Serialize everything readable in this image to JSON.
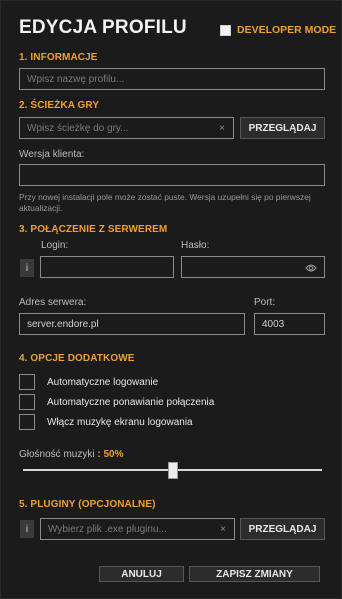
{
  "header": {
    "title": "EDYCJA PROFILU",
    "developer_mode_label": "DEVELOPER MODE",
    "developer_mode_checked": false
  },
  "sections": {
    "info": "1. INFORMACJE",
    "game_path": "2. ŚCIEŻKA GRY",
    "server": "3. POŁĄCZENIE Z SERWEREM",
    "extra": "4. OPCJE DODATKOWE",
    "plugins": "5. PLUGINY (OPCJONALNE)"
  },
  "profile_name": {
    "placeholder": "Wpisz nazwę profilu..."
  },
  "game_path": {
    "placeholder": "Wpisz ścieżkę do gry...",
    "clear_glyph": "×",
    "browse_label": "PRZEGLĄDAJ"
  },
  "client_version": {
    "label": "Wersja klienta:",
    "value": "",
    "note": "Przy nowej instalacji pole może zostać puste. Wersja uzupełni się po pierwszej aktualizacji."
  },
  "server": {
    "info_glyph": "i",
    "login_label": "Login:",
    "password_label": "Hasło:",
    "address_label": "Adres serwera:",
    "address_value": "server.endore.pl",
    "port_label": "Port:",
    "port_value": "4003"
  },
  "options": [
    {
      "label": "Automatyczne logowanie",
      "checked": false
    },
    {
      "label": "Automatyczne ponawianie połączenia",
      "checked": false
    },
    {
      "label": "Włącz muzykę ekranu logowania",
      "checked": false
    }
  ],
  "volume": {
    "label": "Głośność muzyki",
    "value_text": ": 50%",
    "value": 0.5
  },
  "plugins": {
    "info_glyph": "i",
    "placeholder": "Wybierz plik .exe pluginu...",
    "clear_glyph": "×",
    "browse_label": "PRZEGLĄDAJ"
  },
  "footer": {
    "cancel_label": "ANULUJ",
    "save_label": "ZAPISZ ZMIANY"
  },
  "colors": {
    "accent": "#f0a032",
    "background": "#1b1b1b",
    "border": "#8a8a8a"
  }
}
